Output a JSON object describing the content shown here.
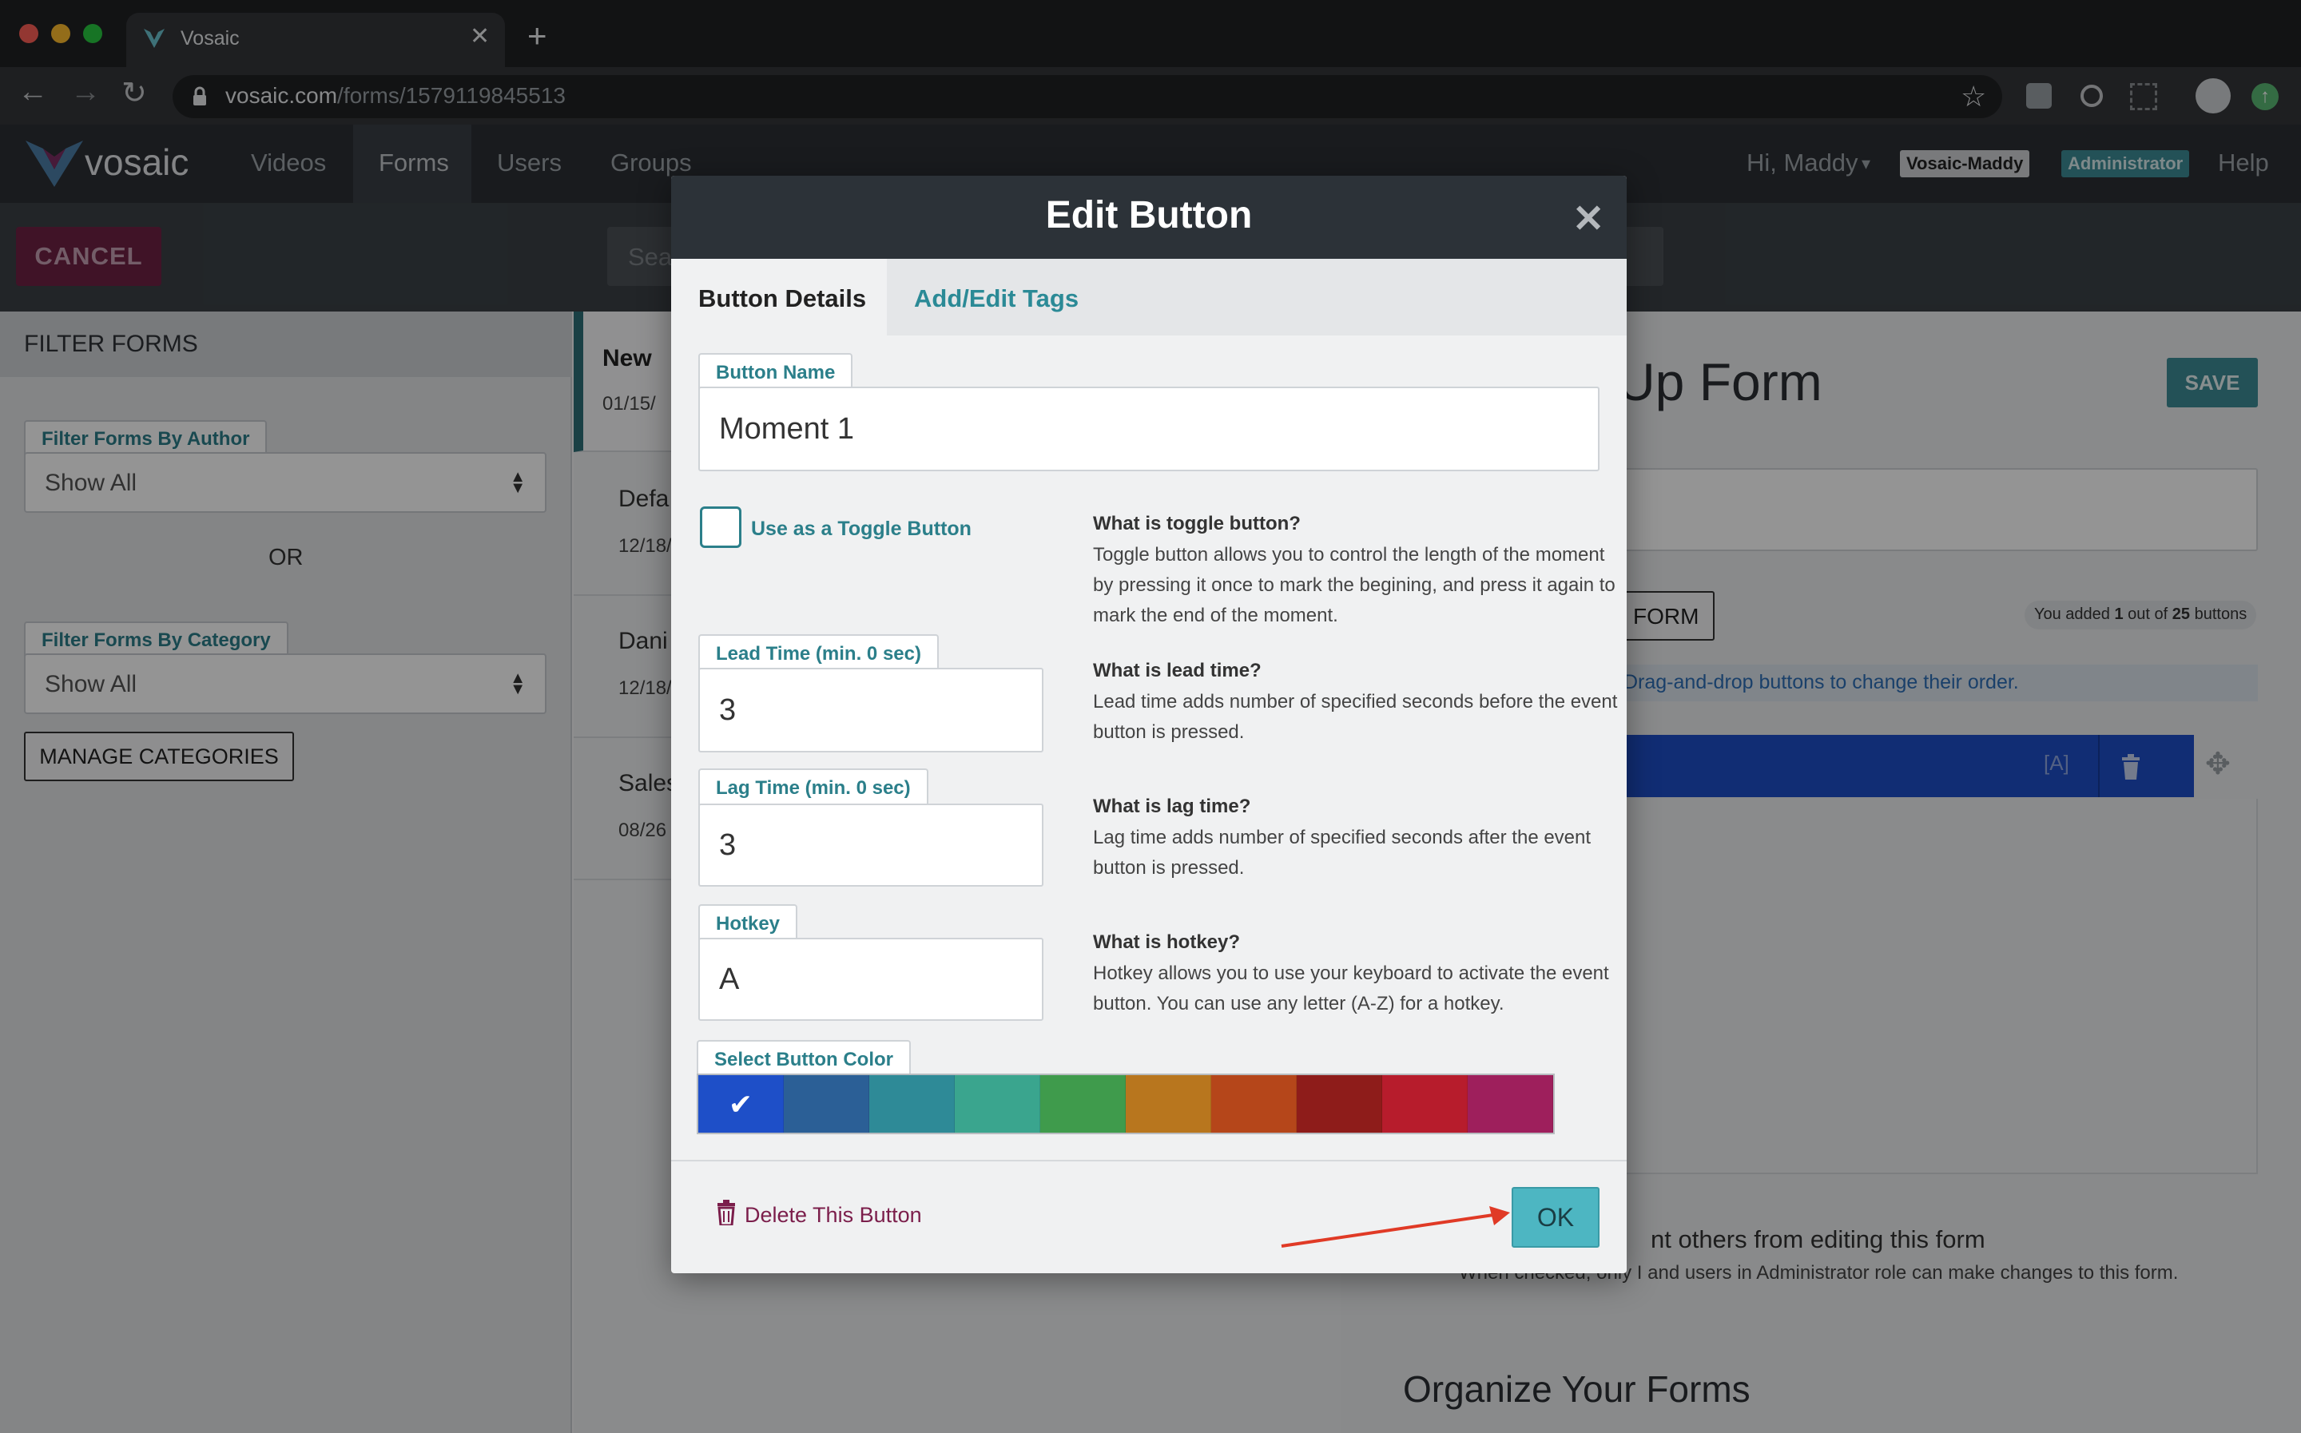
{
  "browser": {
    "tab_title": "Vosaic",
    "url_host": "vosaic.com",
    "url_path": "/forms/1579119845513"
  },
  "navbar": {
    "logo": "vosaic",
    "links": [
      "Videos",
      "Forms",
      "Users",
      "Groups"
    ],
    "greeting": "Hi, Maddy",
    "org_badge": "Vosaic-Maddy",
    "role_badge": "Administrator",
    "help": "Help"
  },
  "actionbar": {
    "cancel_label": "CANCEL",
    "search_placeholder": "Sea"
  },
  "sidebar": {
    "header": "FILTER FORMS",
    "author_label": "Filter Forms By Author",
    "author_value": "Show All",
    "or_text": "OR",
    "category_label": "Filter Forms By Category",
    "category_value": "Show All",
    "manage_label": "MANAGE CATEGORIES"
  },
  "middle": {
    "rows": [
      {
        "title": "New",
        "date": "01/15/"
      },
      {
        "title": "Defa",
        "date": "12/18/"
      },
      {
        "title": "Dani",
        "date": "12/18/"
      },
      {
        "title": "Sales",
        "date": "08/26"
      }
    ]
  },
  "right": {
    "form_title_fragment": "Up Form",
    "save_label": "SAVE",
    "form_button_fragment": "FORM",
    "count_prefix": "You added",
    "count_value": "1",
    "count_mid": "out of",
    "count_total": "25",
    "count_suffix": "buttons",
    "drag_hint": "Drag-and-drop buttons to change their order.",
    "hotkey_hint": "[A]",
    "prevent_text": "nt others from editing this form",
    "prevent_sub": "When checked, only I and users in Administrator role can make changes to this form.",
    "organize_title": "Organize Your Forms"
  },
  "modal": {
    "title": "Edit Button",
    "tabs": [
      "Button Details",
      "Add/Edit Tags"
    ],
    "button_name_label": "Button Name",
    "button_name_value": "Moment 1",
    "toggle_label": "Use as a Toggle Button",
    "toggle_checked": false,
    "lead_label": "Lead Time (min. 0 sec)",
    "lead_value": "3",
    "lag_label": "Lag Time (min. 0 sec)",
    "lag_value": "3",
    "hotkey_label": "Hotkey",
    "hotkey_value": "A",
    "help": {
      "toggle_title": "What is toggle button?",
      "toggle_text": "Toggle button allows you to control the length of the moment by pressing it once to mark the begining, and press it again to mark the end of the moment.",
      "lead_title": "What is lead time?",
      "lead_text": "Lead time adds number of specified seconds before the event button is pressed.",
      "lag_title": "What is lag time?",
      "lag_text": "Lag time adds number of specified seconds after the event button is pressed.",
      "hotkey_title": "What is hotkey?",
      "hotkey_text": "Hotkey allows you to use your keyboard to activate the event button. You can use any letter (A-Z) for a hotkey."
    },
    "color_label": "Select Button Color",
    "colors": [
      "#1e4fc8",
      "#2b5f96",
      "#2e8a97",
      "#3aa58e",
      "#3f9b4c",
      "#b8761e",
      "#b5461a",
      "#8e1c1a",
      "#b71c2c",
      "#9e1f5c"
    ],
    "selected_color_index": 0,
    "delete_label": "Delete This Button",
    "ok_label": "OK"
  }
}
